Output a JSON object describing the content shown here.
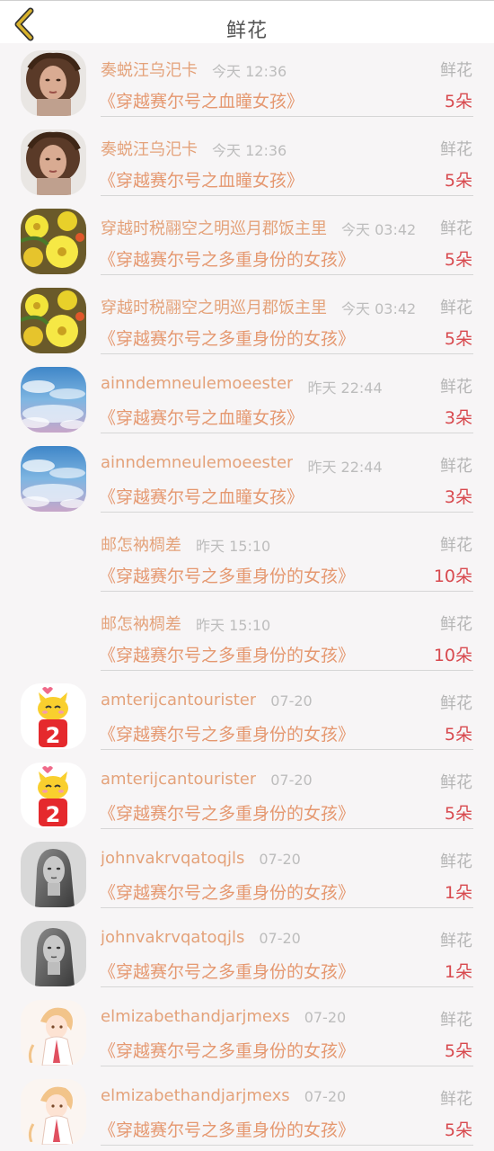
{
  "header": {
    "title": "鲜花",
    "back_icon": "chevron-left-icon",
    "accent": "#d8b22c"
  },
  "colors": {
    "name": "#e4a27a",
    "time": "#bdbdbd",
    "book": "#e59870",
    "count": "#d84a4f",
    "type": "#b5b5b5"
  },
  "items": [
    {
      "avatar": "woman-curly-hair-photo",
      "name": "奏蜕汪乌汜卡",
      "time": "今天 12:36",
      "type": "鲜花",
      "book": "《穿越赛尔号之血瞳女孩》",
      "count": "5朵"
    },
    {
      "avatar": "woman-curly-hair-photo",
      "name": "奏蜕汪乌汜卡",
      "time": "今天 12:36",
      "type": "鲜花",
      "book": "《穿越赛尔号之血瞳女孩》",
      "count": "5朵"
    },
    {
      "avatar": "yellow-flowers-photo",
      "name": "穿越时税翮空之明巡月郡饭主里",
      "time": "今天 03:42",
      "type": "鲜花",
      "book": "《穿越赛尔号之多重身份的女孩》",
      "count": "5朵"
    },
    {
      "avatar": "yellow-flowers-photo",
      "name": "穿越时税翮空之明巡月郡饭主里",
      "time": "今天 03:42",
      "type": "鲜花",
      "book": "《穿越赛尔号之多重身份的女孩》",
      "count": "5朵"
    },
    {
      "avatar": "sky-clouds-photo",
      "name": "ainndemneulemoeester",
      "time": "昨天 22:44",
      "type": "鲜花",
      "book": "《穿越赛尔号之血瞳女孩》",
      "count": "3朵"
    },
    {
      "avatar": "sky-clouds-photo",
      "name": "ainndemneulemoeester",
      "time": "昨天 22:44",
      "type": "鲜花",
      "book": "《穿越赛尔号之血瞳女孩》",
      "count": "3朵"
    },
    {
      "avatar": "none",
      "name": "邮怎衲椆差",
      "time": "昨天 15:10",
      "type": "鲜花",
      "book": "《穿越赛尔号之多重身份的女孩》",
      "count": "10朵"
    },
    {
      "avatar": "none",
      "name": "邮怎衲椆差",
      "time": "昨天 15:10",
      "type": "鲜花",
      "book": "《穿越赛尔号之多重身份的女孩》",
      "count": "10朵"
    },
    {
      "avatar": "cartoon-cat-2-badge",
      "name": "amterijcantourister",
      "time": "07-20",
      "type": "鲜花",
      "book": "《穿越赛尔号之多重身份的女孩》",
      "count": "5朵"
    },
    {
      "avatar": "cartoon-cat-2-badge",
      "name": "amterijcantourister",
      "time": "07-20",
      "type": "鲜花",
      "book": "《穿越赛尔号之多重身份的女孩》",
      "count": "5朵"
    },
    {
      "avatar": "woman-bw-photo",
      "name": "johnvakrvqatoqjls",
      "time": "07-20",
      "type": "鲜花",
      "book": "《穿越赛尔号之多重身份的女孩》",
      "count": "1朵"
    },
    {
      "avatar": "woman-bw-photo",
      "name": "johnvakrvqatoqjls",
      "time": "07-20",
      "type": "鲜花",
      "book": "《穿越赛尔号之多重身份的女孩》",
      "count": "1朵"
    },
    {
      "avatar": "anime-boy-illustration",
      "name": "elmizabethandjarjmexs",
      "time": "07-20",
      "type": "鲜花",
      "book": "《穿越赛尔号之多重身份的女孩》",
      "count": "5朵"
    },
    {
      "avatar": "anime-boy-illustration",
      "name": "elmizabethandjarjmexs",
      "time": "07-20",
      "type": "鲜花",
      "book": "《穿越赛尔号之多重身份的女孩》",
      "count": "5朵"
    }
  ]
}
